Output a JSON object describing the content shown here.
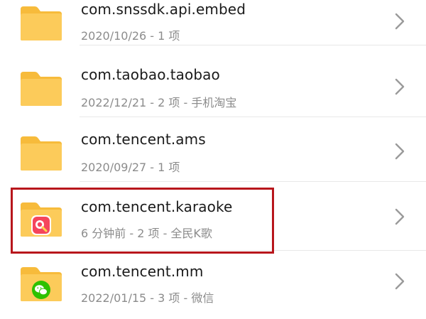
{
  "colors": {
    "folder": "#FCCB5A",
    "folder_tab": "#F7BB3B",
    "highlight": "#B8161C",
    "name_text": "#1A1A1A",
    "meta_text": "#8C8C8C"
  },
  "files": [
    {
      "name": "com.snssdk.api.embed",
      "meta": "2020/10/26 - 1 项",
      "badge": null
    },
    {
      "name": "com.taobao.taobao",
      "meta": "2022/12/21 - 2 项 - 手机淘宝",
      "badge": null
    },
    {
      "name": "com.tencent.ams",
      "meta": "2020/09/27 - 1 项",
      "badge": null
    },
    {
      "name": "com.tencent.karaoke",
      "meta": "6 分钟前 - 2 项 - 全民K歌",
      "badge": "karaoke-app-icon",
      "highlighted": true
    },
    {
      "name": "com.tencent.mm",
      "meta": "2022/01/15 - 3 项 - 微信",
      "badge": "wechat-app-icon"
    }
  ]
}
